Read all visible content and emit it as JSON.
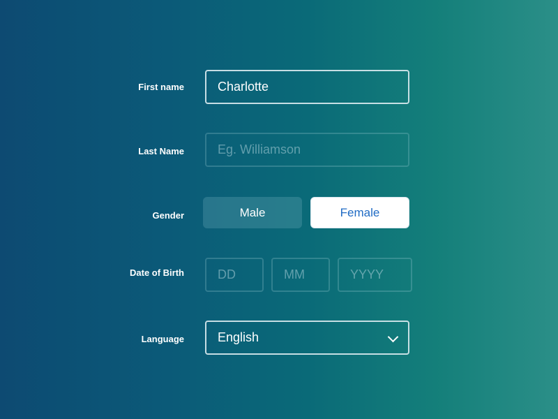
{
  "form": {
    "first_name": {
      "label": "First name",
      "value": "Charlotte"
    },
    "last_name": {
      "label": "Last Name",
      "placeholder": "Eg. Williamson"
    },
    "gender": {
      "label": "Gender",
      "options": [
        "Male",
        "Female"
      ],
      "selected": "Female"
    },
    "dob": {
      "label": "Date of Birth",
      "day_placeholder": "DD",
      "month_placeholder": "MM",
      "year_placeholder": "YYYY"
    },
    "language": {
      "label": "Language",
      "value": "English",
      "icon": "chevron-down-icon"
    }
  },
  "colors": {
    "selected_text": "#1f6bc4"
  }
}
